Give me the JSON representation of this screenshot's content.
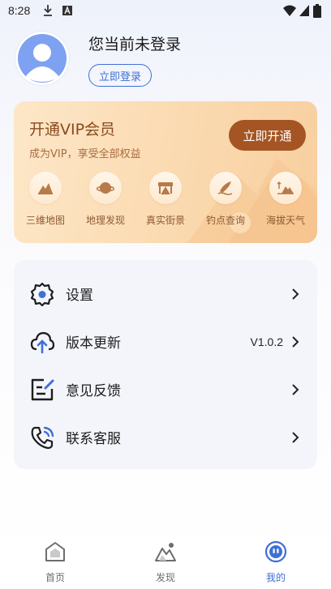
{
  "status_bar": {
    "time": "8:28",
    "icons": [
      "download-icon",
      "a-notification-icon",
      "wifi-icon",
      "signal-icon",
      "battery-icon"
    ]
  },
  "profile": {
    "avatar_icon": "user-avatar-icon",
    "title": "您当前未登录",
    "login_button": "立即登录"
  },
  "vip": {
    "title": "开通VIP会员",
    "subtitle": "成为VIP，享受全部权益",
    "open_button": "立即开通",
    "features": [
      {
        "label": "三维地图",
        "icon": "3d-map-icon"
      },
      {
        "label": "地理发现",
        "icon": "planet-icon"
      },
      {
        "label": "真实街景",
        "icon": "street-view-icon"
      },
      {
        "label": "钓点查询",
        "icon": "fishing-spot-icon"
      },
      {
        "label": "海拔天气",
        "icon": "altitude-weather-icon"
      }
    ]
  },
  "menu": {
    "items": [
      {
        "label": "设置",
        "icon": "settings-icon",
        "value": ""
      },
      {
        "label": "版本更新",
        "icon": "cloud-upload-icon",
        "value": "V1.0.2"
      },
      {
        "label": "意见反馈",
        "icon": "feedback-edit-icon",
        "value": ""
      },
      {
        "label": "联系客服",
        "icon": "phone-call-icon",
        "value": ""
      }
    ]
  },
  "tabbar": {
    "tabs": [
      {
        "label": "首页",
        "icon": "home-icon",
        "active": false
      },
      {
        "label": "发现",
        "icon": "discover-mountain-icon",
        "active": false
      },
      {
        "label": "我的",
        "icon": "profile-face-icon",
        "active": true
      }
    ]
  },
  "colors": {
    "accent": "#3f6fd8",
    "vip_button": "#a55523",
    "vip_text": "#8a4a1e"
  }
}
